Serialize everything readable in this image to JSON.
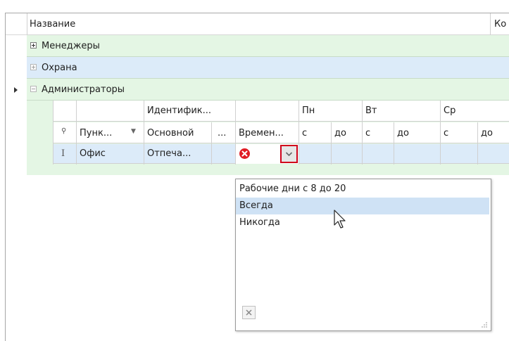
{
  "header": {
    "col_name": "Название",
    "col_partial": "Ко"
  },
  "groups": [
    {
      "label": "Менеджеры",
      "expanded": false
    },
    {
      "label": "Охрана",
      "expanded": false
    },
    {
      "label": "Администраторы",
      "expanded": true
    }
  ],
  "detail": {
    "band_headers": [
      "Идентифик...",
      "Пн",
      "Вт",
      "Ср"
    ],
    "columns": [
      "Пунк...",
      "Основной",
      "...",
      "Времен...",
      "с",
      "до",
      "с",
      "до",
      "с",
      "до"
    ],
    "row": {
      "cursor": "I",
      "point": "Офис",
      "main": "Отпеча..."
    }
  },
  "dropdown": {
    "items": [
      "Рабочие дни с 8 до 20",
      "Всегда",
      "Никогда"
    ],
    "selected_index": 1
  },
  "colors": {
    "green_row": "#e4f6e4",
    "blue_row": "#dcebf9",
    "accent_border": "#d0021b",
    "clear_icon": "#e01c24"
  }
}
